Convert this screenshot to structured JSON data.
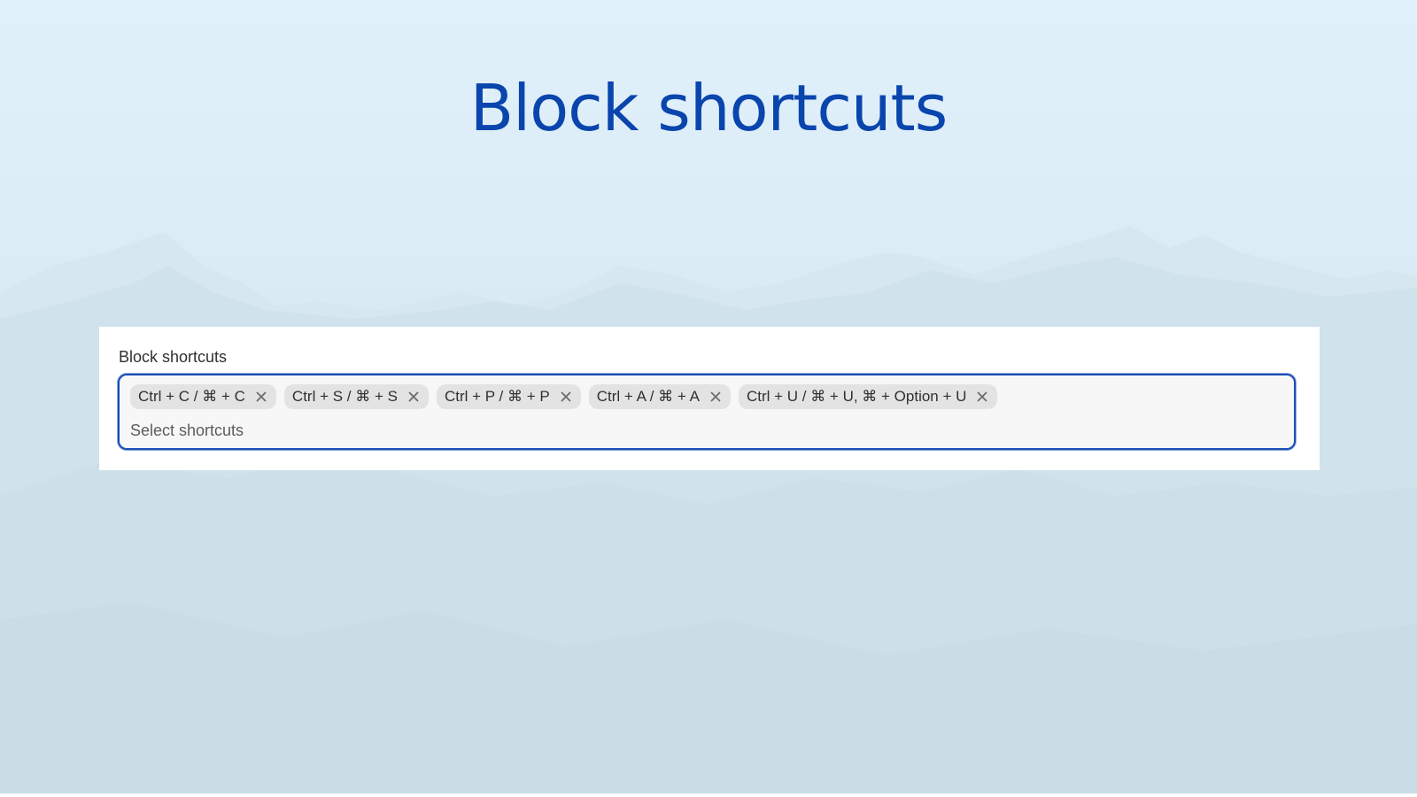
{
  "page": {
    "title": "Block shortcuts"
  },
  "field": {
    "label": "Block shortcuts",
    "placeholder": "Select shortcuts",
    "value": "",
    "chips": [
      {
        "label": "Ctrl + C / ⌘ + C"
      },
      {
        "label": "Ctrl + S / ⌘ + S"
      },
      {
        "label": "Ctrl + P / ⌘ + P"
      },
      {
        "label": "Ctrl + A / ⌘ + A"
      },
      {
        "label": "Ctrl + U / ⌘ + U, ⌘ + Option + U"
      }
    ]
  },
  "colors": {
    "title": "#0a45ad",
    "focus_border": "#1c4eb4",
    "chip_bg": "#e3e3e3",
    "field_bg": "#f7f7f7"
  },
  "icons": {
    "chip_remove": "close-icon"
  }
}
